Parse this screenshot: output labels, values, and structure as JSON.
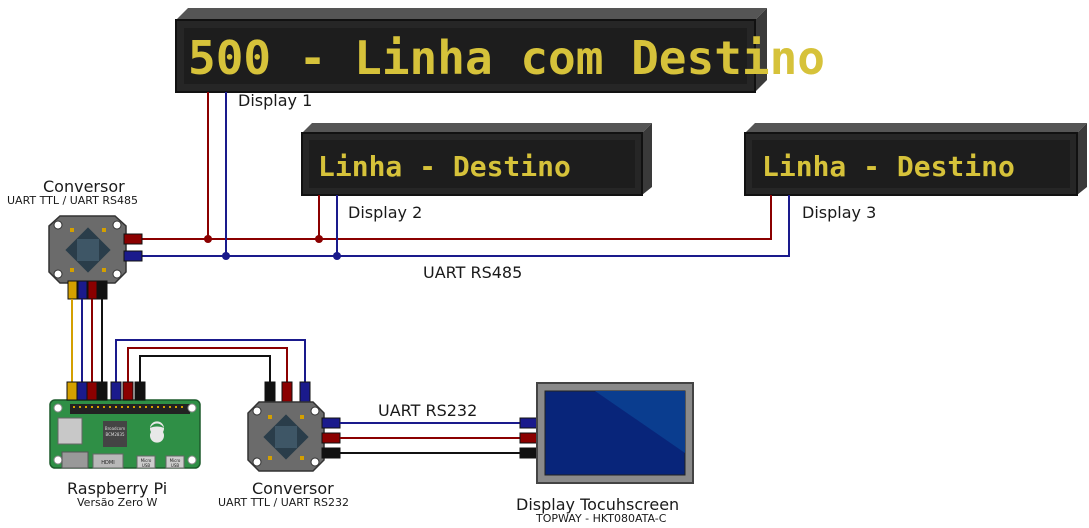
{
  "displays": {
    "d1": {
      "text": "500 - Linha com Destino",
      "label": "Display 1"
    },
    "d2": {
      "text": "Linha - Destino",
      "label": "Display 2"
    },
    "d3": {
      "text": "Linha - Destino",
      "label": "Display 3"
    }
  },
  "converter_rs485": {
    "title": "Conversor",
    "subtitle": "UART TTL / UART RS485"
  },
  "converter_rs232": {
    "title": "Conversor",
    "subtitle": "UART TTL / UART RS232"
  },
  "raspberry": {
    "title": "Raspberry Pi",
    "subtitle": "Versão Zero W",
    "chip_lines": [
      "Broadcom",
      "BCM2835"
    ],
    "port_hdmi": "HDMI",
    "port_usb1": [
      "Micro",
      "USB"
    ],
    "port_usb2": [
      "Micro",
      "USB"
    ]
  },
  "touchscreen": {
    "title": "Display Tocuhscreen",
    "subtitle": "TOPWAY - HKT080ATA-C"
  },
  "buses": {
    "rs485": "UART RS485",
    "rs232": "UART RS232"
  },
  "colors": {
    "wire_red": "#8b0000",
    "wire_blue": "#1a1a8c",
    "wire_black": "#111111",
    "wire_yellow": "#d4a000",
    "led_text": "#d6c23a",
    "panel": "#2a2a2a",
    "pcb_green": "#2f8f46",
    "screen_blue": "#08257a"
  }
}
